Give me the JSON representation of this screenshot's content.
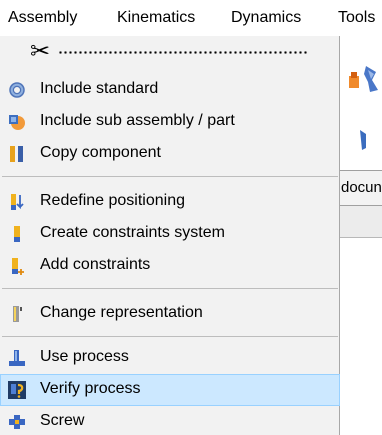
{
  "menubar": {
    "items": [
      {
        "label": "Assembly"
      },
      {
        "label": "Kinematics"
      },
      {
        "label": "Dynamics"
      },
      {
        "label": "Tools"
      }
    ]
  },
  "background": {
    "doc_tab_label": "docun"
  },
  "menu": {
    "items": [
      {
        "label": "Include standard",
        "icon": "gear-ring-icon"
      },
      {
        "label": "Include sub assembly / part",
        "icon": "subassembly-icon"
      },
      {
        "label": "Copy component",
        "icon": "copy-component-icon"
      },
      {
        "label": "Redefine positioning",
        "icon": "redefine-positioning-icon"
      },
      {
        "label": "Create constraints system",
        "icon": "constraints-system-icon"
      },
      {
        "label": "Add constraints",
        "icon": "add-constraints-icon"
      },
      {
        "label": "Change representation",
        "icon": "representation-icon"
      },
      {
        "label": "Use process",
        "icon": "use-process-icon"
      },
      {
        "label": "Verify process",
        "icon": "verify-process-icon",
        "selected": true
      },
      {
        "label": "Screw",
        "icon": "screw-icon"
      }
    ]
  },
  "colors": {
    "menu_bg": "#f2f2f2",
    "selection_bg": "#cce8ff",
    "selection_border": "#99d1ff",
    "separator": "#bdbdbd"
  }
}
